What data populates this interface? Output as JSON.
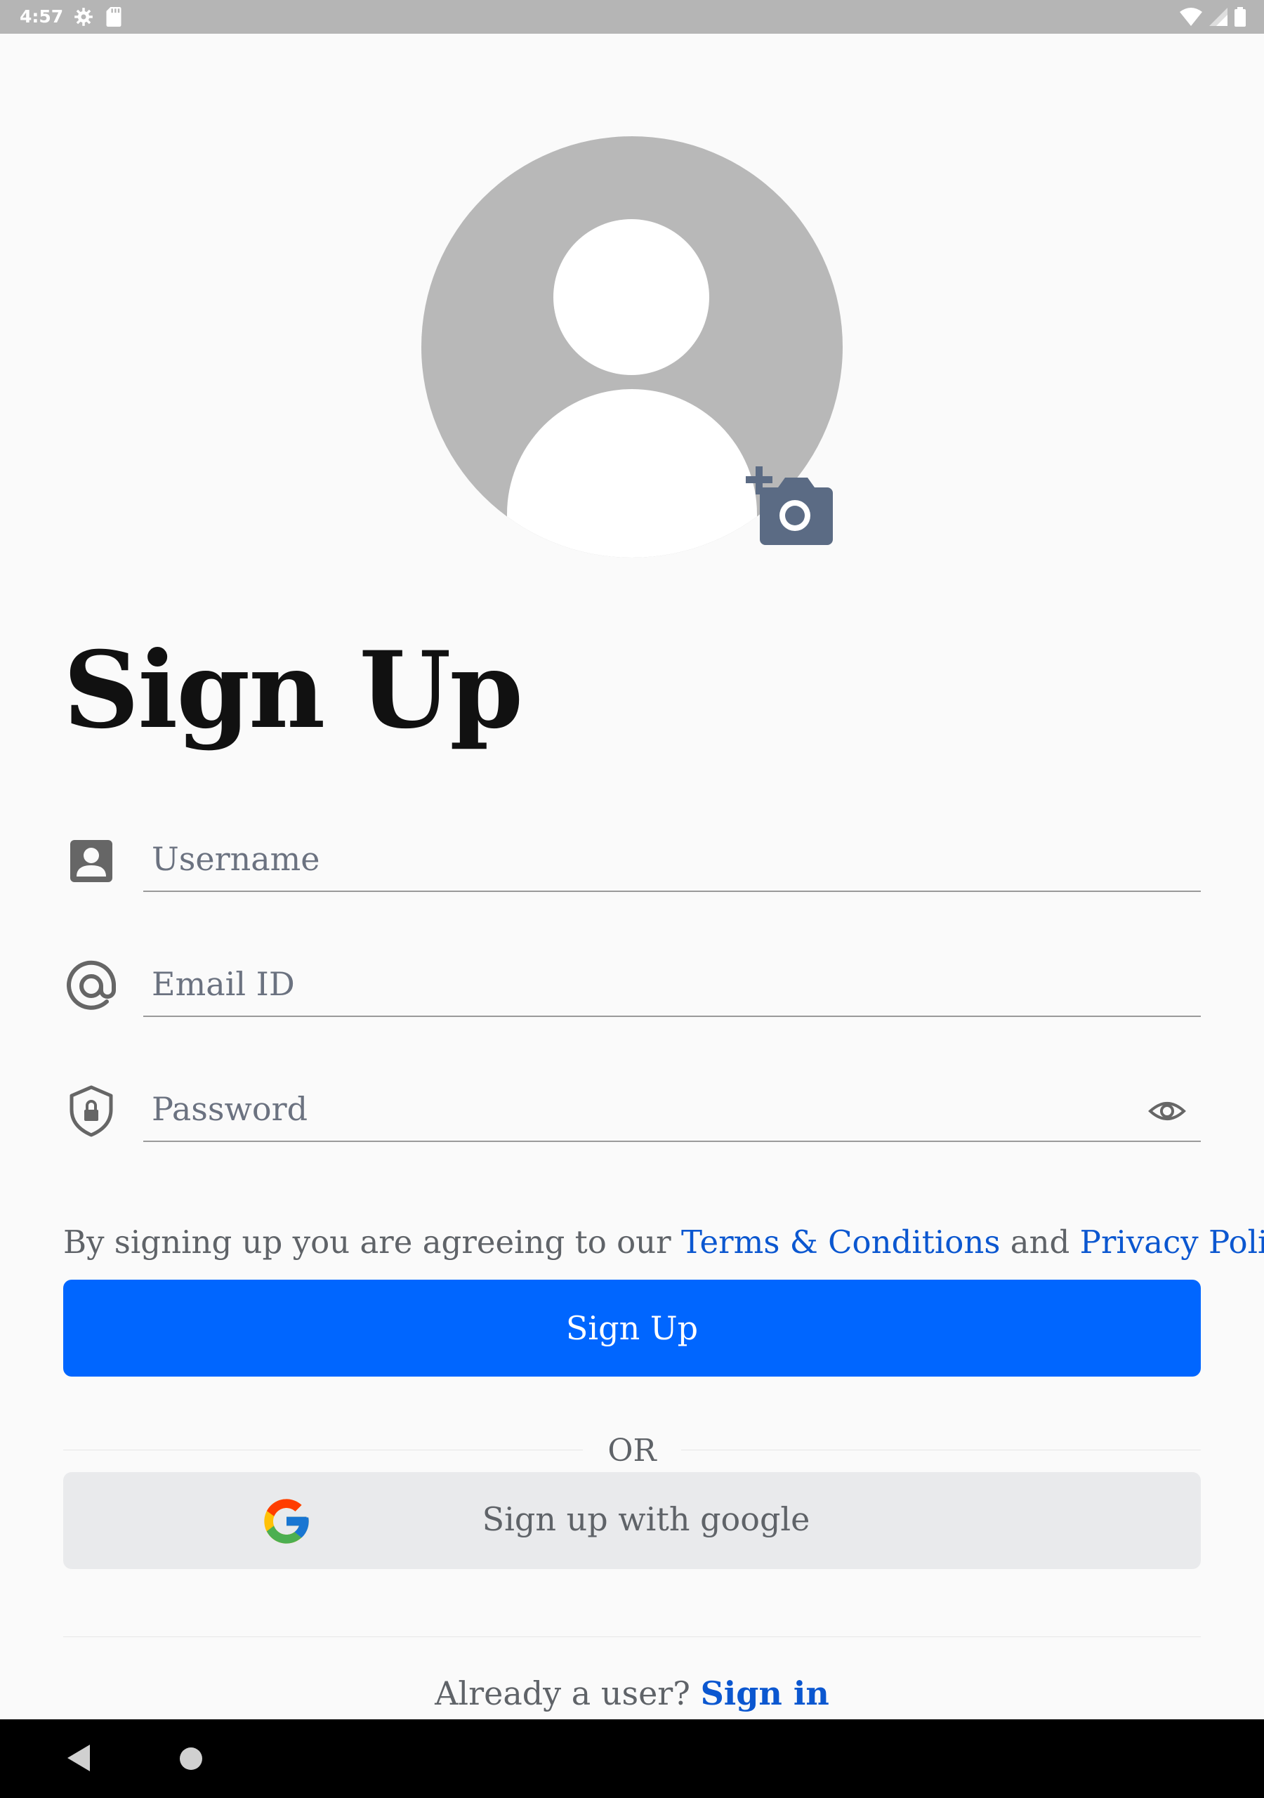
{
  "status_bar": {
    "time": "4:57"
  },
  "profile": {
    "avatar_icon": "person-placeholder-icon",
    "camera_icon": "add-photo-icon"
  },
  "page_title": "Sign Up",
  "fields": {
    "username": {
      "placeholder": "Username",
      "icon": "account-box-icon"
    },
    "email": {
      "placeholder": "Email ID",
      "icon": "at-sign-icon"
    },
    "password": {
      "placeholder": "Password",
      "icon": "shield-lock-icon",
      "toggle_icon": "eye-icon"
    }
  },
  "terms": {
    "prefix": "By signing up you are agreeing to our ",
    "terms_link": "Terms & Conditions",
    "middle": " and ",
    "privacy_link": "Privacy Policy"
  },
  "signup_button": "Sign Up",
  "or_text": "OR",
  "google_button": "Sign up with google",
  "signin": {
    "prompt": "Already a user? ",
    "link": "Sign in"
  },
  "colors": {
    "primary": "#0066ff",
    "link": "#0b57d0",
    "avatar_bg": "#b8b8b8",
    "camera_icon": "#5b6b84"
  }
}
